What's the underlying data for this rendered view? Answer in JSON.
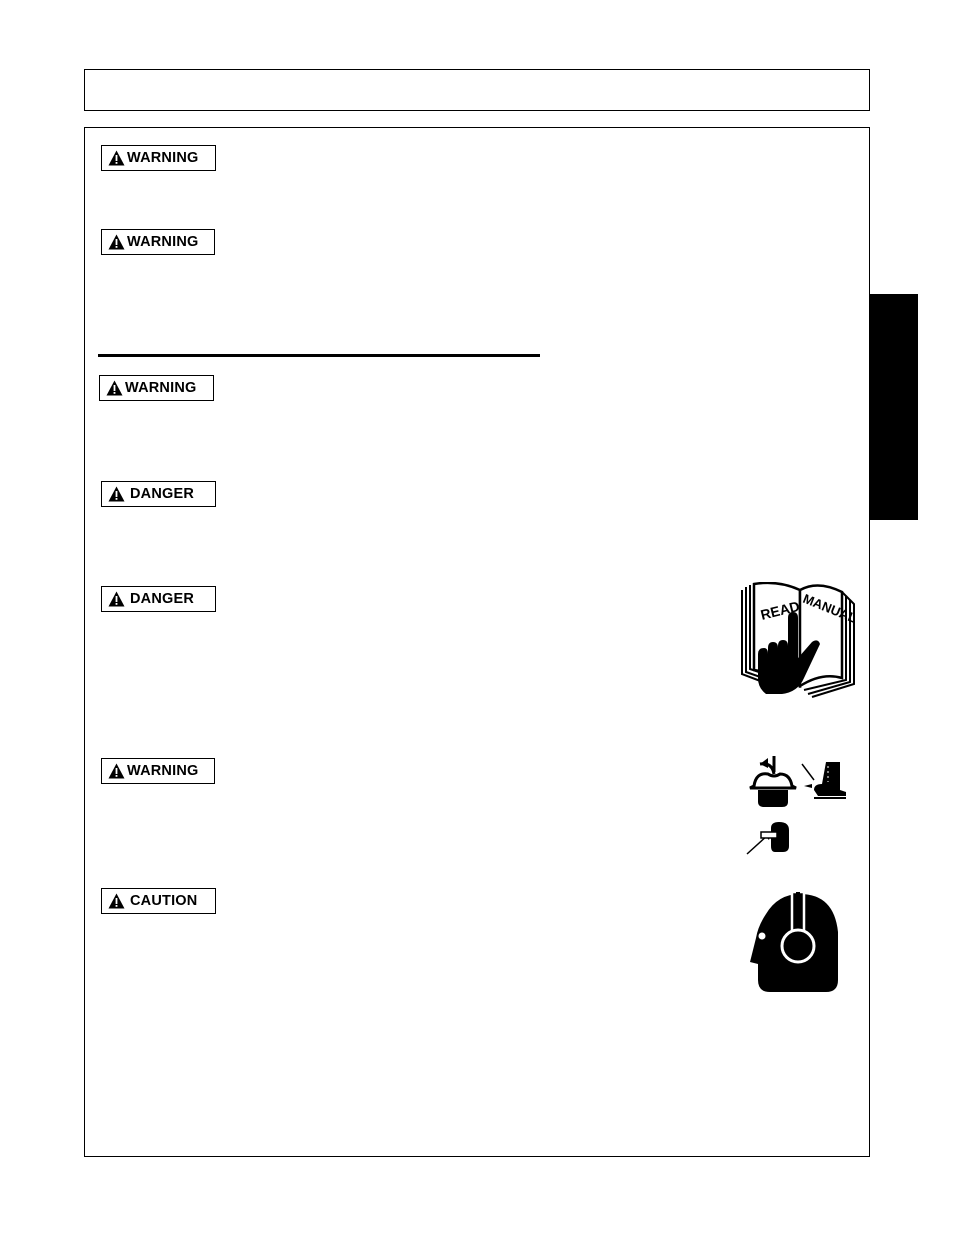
{
  "page": {
    "header_title": "",
    "side_tab_label": "",
    "colors": {
      "ink": "#000000",
      "paper": "#ffffff"
    }
  },
  "signals": [
    {
      "word": "WARNING",
      "icon": "warning-triangle-icon",
      "body": ""
    },
    {
      "word": "WARNING",
      "icon": "warning-triangle-icon",
      "body": ""
    },
    {
      "word": "WARNING",
      "icon": "warning-triangle-icon",
      "body": ""
    },
    {
      "word": "DANGER",
      "icon": "warning-triangle-icon",
      "body": ""
    },
    {
      "word": "DANGER",
      "icon": "warning-triangle-icon",
      "body": ""
    },
    {
      "word": "WARNING",
      "icon": "warning-triangle-icon",
      "body": ""
    },
    {
      "word": "CAUTION",
      "icon": "warning-triangle-icon",
      "body": ""
    }
  ],
  "illustrations": {
    "read_manual": {
      "icon": "read-manual-icon",
      "left_page_text": "READ",
      "right_page_text": "MANUAL"
    },
    "ppe": {
      "icons": [
        "hard-hat-icon",
        "safety-boot-icon",
        "safety-glasses-icon"
      ]
    },
    "hearing": {
      "icon": "hearing-protection-icon"
    }
  }
}
